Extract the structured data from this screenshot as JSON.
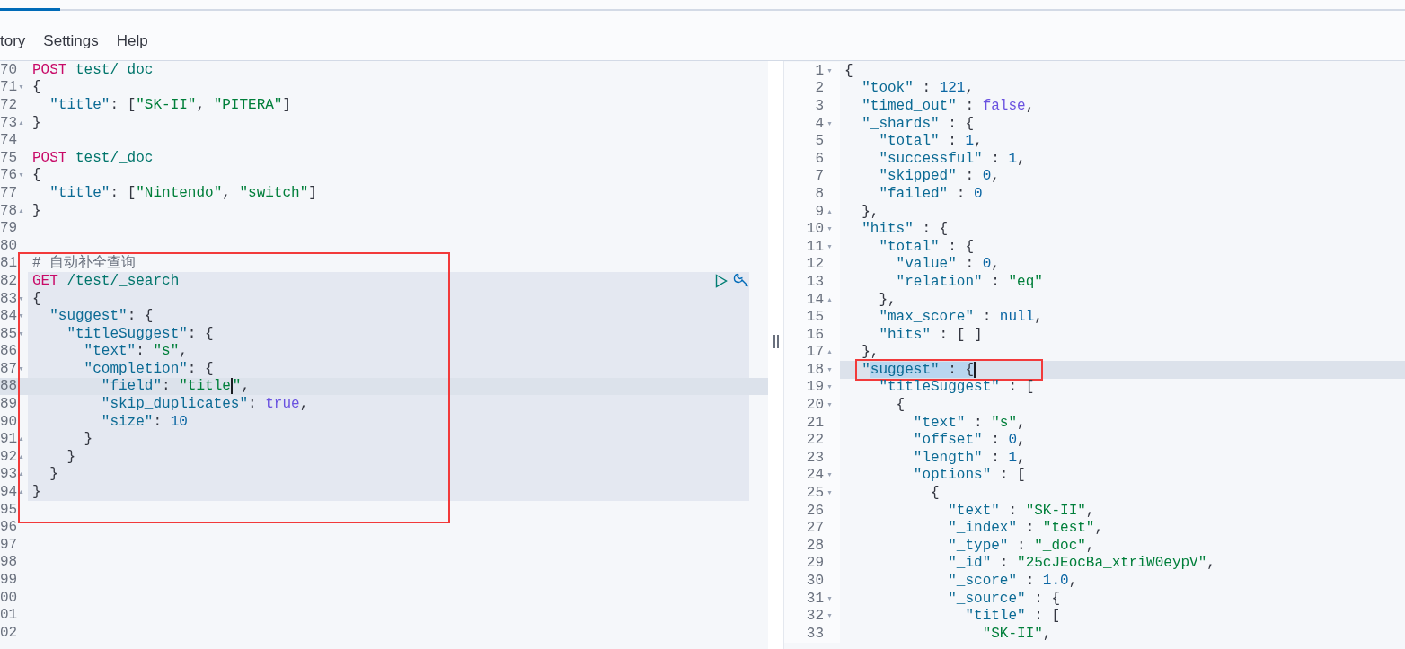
{
  "tabs": [
    {
      "selected": true
    }
  ],
  "menu": [
    {
      "label": "tory"
    },
    {
      "label": "Settings"
    },
    {
      "label": "Help"
    }
  ],
  "request_editor": {
    "red_box": true,
    "lines": [
      {
        "number": "70",
        "tokens": [
          {
            "kind": "method",
            "text": "POST"
          },
          {
            "kind": "url",
            "text": " test/_doc"
          }
        ]
      },
      {
        "number": "71",
        "fold": "▾",
        "tokens": [
          {
            "kind": "punct",
            "text": "{"
          }
        ]
      },
      {
        "number": "72",
        "tokens": [
          {
            "kind": "key",
            "text": "  \"title\""
          },
          {
            "kind": "punct",
            "text": ": ["
          },
          {
            "kind": "string",
            "text": "\"SK-II\""
          },
          {
            "kind": "punct",
            "text": ", "
          },
          {
            "kind": "string",
            "text": "\"PITERA\""
          },
          {
            "kind": "punct",
            "text": "]"
          }
        ]
      },
      {
        "number": "73",
        "fold": "▴",
        "tokens": [
          {
            "kind": "punct",
            "text": "}"
          }
        ]
      },
      {
        "number": "74"
      },
      {
        "number": "75",
        "tokens": [
          {
            "kind": "method",
            "text": "POST"
          },
          {
            "kind": "url",
            "text": " test/_doc"
          }
        ]
      },
      {
        "number": "76",
        "fold": "▾",
        "tokens": [
          {
            "kind": "punct",
            "text": "{"
          }
        ]
      },
      {
        "number": "77",
        "tokens": [
          {
            "kind": "key",
            "text": "  \"title\""
          },
          {
            "kind": "punct",
            "text": ": ["
          },
          {
            "kind": "string",
            "text": "\"Nintendo\""
          },
          {
            "kind": "punct",
            "text": ", "
          },
          {
            "kind": "string",
            "text": "\"switch\""
          },
          {
            "kind": "punct",
            "text": "]"
          }
        ]
      },
      {
        "number": "78",
        "fold": "▴",
        "tokens": [
          {
            "kind": "punct",
            "text": "}"
          }
        ]
      },
      {
        "number": "79"
      },
      {
        "number": "80"
      },
      {
        "number": "81",
        "tokens": [
          {
            "kind": "comment",
            "text": "# 自动补全查询"
          }
        ]
      },
      {
        "number": "82",
        "request": true,
        "actions": true,
        "tokens": [
          {
            "kind": "method",
            "text": "GET"
          },
          {
            "kind": "url",
            "text": " /test/_search"
          }
        ]
      },
      {
        "number": "83",
        "request": true,
        "fold": "▾",
        "tokens": [
          {
            "kind": "punct",
            "text": "{"
          }
        ]
      },
      {
        "number": "84",
        "request": true,
        "fold": "▾",
        "tokens": [
          {
            "kind": "key",
            "text": "  \"suggest\""
          },
          {
            "kind": "punct",
            "text": ": {"
          }
        ]
      },
      {
        "number": "85",
        "request": true,
        "fold": "▾",
        "tokens": [
          {
            "kind": "key",
            "text": "    \"titleSuggest\""
          },
          {
            "kind": "punct",
            "text": ": {"
          }
        ]
      },
      {
        "number": "86",
        "request": true,
        "tokens": [
          {
            "kind": "key",
            "text": "      \"text\""
          },
          {
            "kind": "punct",
            "text": ": "
          },
          {
            "kind": "string",
            "text": "\"s\""
          },
          {
            "kind": "punct",
            "text": ","
          }
        ]
      },
      {
        "number": "87",
        "request": true,
        "fold": "▾",
        "tokens": [
          {
            "kind": "key",
            "text": "      \"completion\""
          },
          {
            "kind": "punct",
            "text": ": {"
          }
        ]
      },
      {
        "number": "88",
        "request": true,
        "active": true,
        "tokens": [
          {
            "kind": "key",
            "text": "        \"field\""
          },
          {
            "kind": "punct",
            "text": ": "
          },
          {
            "kind": "string",
            "text": "\"title",
            "cursor_after": true
          },
          {
            "kind": "string",
            "text": "\""
          },
          {
            "kind": "punct",
            "text": ","
          }
        ]
      },
      {
        "number": "89",
        "request": true,
        "tokens": [
          {
            "kind": "key",
            "text": "        \"skip_duplicates\""
          },
          {
            "kind": "punct",
            "text": ": "
          },
          {
            "kind": "literal",
            "text": "true"
          },
          {
            "kind": "punct",
            "text": ","
          }
        ]
      },
      {
        "number": "90",
        "request": true,
        "tokens": [
          {
            "kind": "key",
            "text": "        \"size\""
          },
          {
            "kind": "punct",
            "text": ": "
          },
          {
            "kind": "number",
            "text": "10"
          }
        ]
      },
      {
        "number": "91",
        "request": true,
        "fold": "▴",
        "tokens": [
          {
            "kind": "punct",
            "text": "      }"
          }
        ]
      },
      {
        "number": "92",
        "request": true,
        "fold": "▴",
        "tokens": [
          {
            "kind": "punct",
            "text": "    }"
          }
        ]
      },
      {
        "number": "93",
        "request": true,
        "fold": "▴",
        "tokens": [
          {
            "kind": "punct",
            "text": "  }"
          }
        ]
      },
      {
        "number": "94",
        "request": true,
        "fold": "▴",
        "tokens": [
          {
            "kind": "punct",
            "text": "}"
          }
        ]
      },
      {
        "number": "95"
      },
      {
        "number": "96"
      },
      {
        "number": "97"
      },
      {
        "number": "98"
      },
      {
        "number": "99"
      },
      {
        "number": "00"
      },
      {
        "number": "01"
      },
      {
        "number": "02"
      }
    ]
  },
  "response_editor": {
    "lines": [
      {
        "number": "1",
        "fold": "▾",
        "tokens": [
          {
            "kind": "punct",
            "text": "{"
          }
        ]
      },
      {
        "number": "2",
        "tokens": [
          {
            "kind": "key",
            "text": "  \"took\""
          },
          {
            "kind": "punct",
            "text": " : "
          },
          {
            "kind": "number",
            "text": "121"
          },
          {
            "kind": "punct",
            "text": ","
          }
        ]
      },
      {
        "number": "3",
        "tokens": [
          {
            "kind": "key",
            "text": "  \"timed_out\""
          },
          {
            "kind": "punct",
            "text": " : "
          },
          {
            "kind": "literal",
            "text": "false"
          },
          {
            "kind": "punct",
            "text": ","
          }
        ]
      },
      {
        "number": "4",
        "fold": "▾",
        "tokens": [
          {
            "kind": "key",
            "text": "  \"_shards\""
          },
          {
            "kind": "punct",
            "text": " : {"
          }
        ]
      },
      {
        "number": "5",
        "tokens": [
          {
            "kind": "key",
            "text": "    \"total\""
          },
          {
            "kind": "punct",
            "text": " : "
          },
          {
            "kind": "number",
            "text": "1"
          },
          {
            "kind": "punct",
            "text": ","
          }
        ]
      },
      {
        "number": "6",
        "tokens": [
          {
            "kind": "key",
            "text": "    \"successful\""
          },
          {
            "kind": "punct",
            "text": " : "
          },
          {
            "kind": "number",
            "text": "1"
          },
          {
            "kind": "punct",
            "text": ","
          }
        ]
      },
      {
        "number": "7",
        "tokens": [
          {
            "kind": "key",
            "text": "    \"skipped\""
          },
          {
            "kind": "punct",
            "text": " : "
          },
          {
            "kind": "number",
            "text": "0"
          },
          {
            "kind": "punct",
            "text": ","
          }
        ]
      },
      {
        "number": "8",
        "tokens": [
          {
            "kind": "key",
            "text": "    \"failed\""
          },
          {
            "kind": "punct",
            "text": " : "
          },
          {
            "kind": "number",
            "text": "0"
          }
        ]
      },
      {
        "number": "9",
        "fold": "▴",
        "tokens": [
          {
            "kind": "punct",
            "text": "  },"
          }
        ]
      },
      {
        "number": "10",
        "fold": "▾",
        "tokens": [
          {
            "kind": "key",
            "text": "  \"hits\""
          },
          {
            "kind": "punct",
            "text": " : {"
          }
        ]
      },
      {
        "number": "11",
        "fold": "▾",
        "tokens": [
          {
            "kind": "key",
            "text": "    \"total\""
          },
          {
            "kind": "punct",
            "text": " : {"
          }
        ]
      },
      {
        "number": "12",
        "tokens": [
          {
            "kind": "key",
            "text": "      \"value\""
          },
          {
            "kind": "punct",
            "text": " : "
          },
          {
            "kind": "number",
            "text": "0"
          },
          {
            "kind": "punct",
            "text": ","
          }
        ]
      },
      {
        "number": "13",
        "tokens": [
          {
            "kind": "key",
            "text": "      \"relation\""
          },
          {
            "kind": "punct",
            "text": " : "
          },
          {
            "kind": "string",
            "text": "\"eq\""
          }
        ]
      },
      {
        "number": "14",
        "fold": "▴",
        "tokens": [
          {
            "kind": "punct",
            "text": "    },"
          }
        ]
      },
      {
        "number": "15",
        "tokens": [
          {
            "kind": "key",
            "text": "    \"max_score\""
          },
          {
            "kind": "punct",
            "text": " : "
          },
          {
            "kind": "number",
            "text": "null"
          },
          {
            "kind": "punct",
            "text": ","
          }
        ]
      },
      {
        "number": "16",
        "tokens": [
          {
            "kind": "key",
            "text": "    \"hits\""
          },
          {
            "kind": "punct",
            "text": " : [ ]"
          }
        ]
      },
      {
        "number": "17",
        "fold": "▴",
        "tokens": [
          {
            "kind": "punct",
            "text": "  },"
          }
        ]
      },
      {
        "number": "18",
        "fold": "▾",
        "active": true,
        "red_box": true,
        "tokens": [
          {
            "kind": "key",
            "text": "  \""
          },
          {
            "kind": "key",
            "text": "suggest\"",
            "selected": true
          },
          {
            "kind": "punct",
            "text": " : ",
            "selected": true
          },
          {
            "kind": "punct",
            "text": "{",
            "selected": true,
            "cursor_after": true
          }
        ]
      },
      {
        "number": "19",
        "fold": "▾",
        "tokens": [
          {
            "kind": "key",
            "text": "    \"titleSuggest\""
          },
          {
            "kind": "punct",
            "text": " : ["
          }
        ]
      },
      {
        "number": "20",
        "fold": "▾",
        "tokens": [
          {
            "kind": "punct",
            "text": "      {"
          }
        ]
      },
      {
        "number": "21",
        "tokens": [
          {
            "kind": "key",
            "text": "        \"text\""
          },
          {
            "kind": "punct",
            "text": " : "
          },
          {
            "kind": "string",
            "text": "\"s\""
          },
          {
            "kind": "punct",
            "text": ","
          }
        ]
      },
      {
        "number": "22",
        "tokens": [
          {
            "kind": "key",
            "text": "        \"offset\""
          },
          {
            "kind": "punct",
            "text": " : "
          },
          {
            "kind": "number",
            "text": "0"
          },
          {
            "kind": "punct",
            "text": ","
          }
        ]
      },
      {
        "number": "23",
        "tokens": [
          {
            "kind": "key",
            "text": "        \"length\""
          },
          {
            "kind": "punct",
            "text": " : "
          },
          {
            "kind": "number",
            "text": "1"
          },
          {
            "kind": "punct",
            "text": ","
          }
        ]
      },
      {
        "number": "24",
        "fold": "▾",
        "tokens": [
          {
            "kind": "key",
            "text": "        \"options\""
          },
          {
            "kind": "punct",
            "text": " : ["
          }
        ]
      },
      {
        "number": "25",
        "fold": "▾",
        "tokens": [
          {
            "kind": "punct",
            "text": "          {"
          }
        ]
      },
      {
        "number": "26",
        "tokens": [
          {
            "kind": "key",
            "text": "            \"text\""
          },
          {
            "kind": "punct",
            "text": " : "
          },
          {
            "kind": "string",
            "text": "\"SK-II\""
          },
          {
            "kind": "punct",
            "text": ","
          }
        ]
      },
      {
        "number": "27",
        "tokens": [
          {
            "kind": "key",
            "text": "            \"_index\""
          },
          {
            "kind": "punct",
            "text": " : "
          },
          {
            "kind": "string",
            "text": "\"test\""
          },
          {
            "kind": "punct",
            "text": ","
          }
        ]
      },
      {
        "number": "28",
        "tokens": [
          {
            "kind": "key",
            "text": "            \"_type\""
          },
          {
            "kind": "punct",
            "text": " : "
          },
          {
            "kind": "string",
            "text": "\"_doc\""
          },
          {
            "kind": "punct",
            "text": ","
          }
        ]
      },
      {
        "number": "29",
        "tokens": [
          {
            "kind": "key",
            "text": "            \"_id\""
          },
          {
            "kind": "punct",
            "text": " : "
          },
          {
            "kind": "string",
            "text": "\"25cJEocBa_xtriW0eypV\""
          },
          {
            "kind": "punct",
            "text": ","
          }
        ]
      },
      {
        "number": "30",
        "tokens": [
          {
            "kind": "key",
            "text": "            \"_score\""
          },
          {
            "kind": "punct",
            "text": " : "
          },
          {
            "kind": "number",
            "text": "1.0"
          },
          {
            "kind": "punct",
            "text": ","
          }
        ]
      },
      {
        "number": "31",
        "fold": "▾",
        "tokens": [
          {
            "kind": "key",
            "text": "            \"_source\""
          },
          {
            "kind": "punct",
            "text": " : {"
          }
        ]
      },
      {
        "number": "32",
        "fold": "▾",
        "tokens": [
          {
            "kind": "key",
            "text": "              \"title\""
          },
          {
            "kind": "punct",
            "text": " : ["
          }
        ]
      },
      {
        "number": "33",
        "tokens": [
          {
            "kind": "string",
            "text": "                \"SK-II\""
          },
          {
            "kind": "punct",
            "text": ","
          }
        ]
      }
    ]
  }
}
